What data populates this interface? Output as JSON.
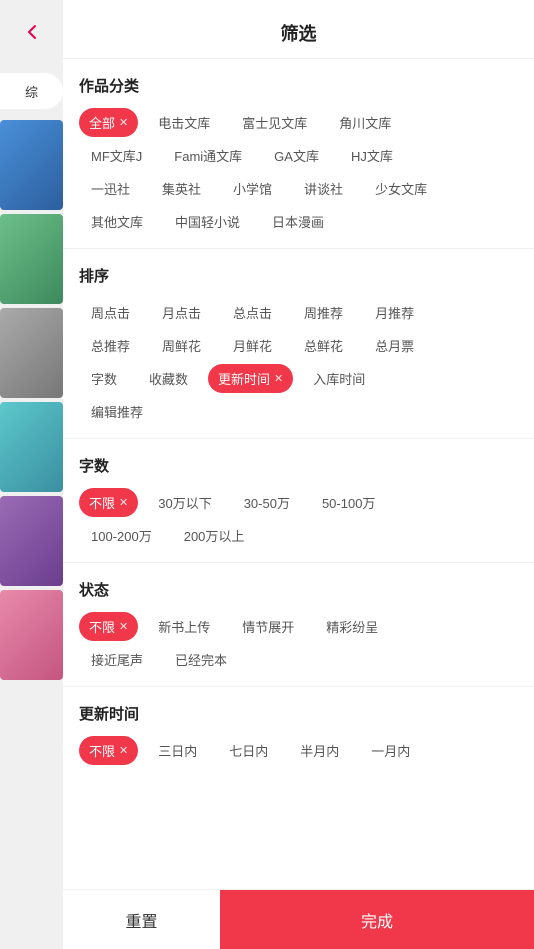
{
  "header": {
    "title": "筛选",
    "back_icon": "‹"
  },
  "sidebar": {
    "tab_label": "综",
    "cards": [
      {
        "color": "blue"
      },
      {
        "color": "green"
      },
      {
        "color": "gray"
      },
      {
        "color": "teal"
      },
      {
        "color": "purple"
      },
      {
        "color": "pink"
      }
    ]
  },
  "sections": {
    "category": {
      "title": "作品分类",
      "tags": [
        {
          "label": "全部",
          "active": true
        },
        {
          "label": "电击文库",
          "active": false
        },
        {
          "label": "富士见文库",
          "active": false
        },
        {
          "label": "角川文库",
          "active": false
        },
        {
          "label": "MF文库J",
          "active": false
        },
        {
          "label": "Fami通文库",
          "active": false
        },
        {
          "label": "GA文库",
          "active": false
        },
        {
          "label": "HJ文库",
          "active": false
        },
        {
          "label": "一迅社",
          "active": false
        },
        {
          "label": "集英社",
          "active": false
        },
        {
          "label": "小学馆",
          "active": false
        },
        {
          "label": "讲谈社",
          "active": false
        },
        {
          "label": "少女文库",
          "active": false
        },
        {
          "label": "其他文库",
          "active": false
        },
        {
          "label": "中国轻小说",
          "active": false
        },
        {
          "label": "日本漫画",
          "active": false
        }
      ]
    },
    "sort": {
      "title": "排序",
      "tags": [
        {
          "label": "周点击",
          "active": false
        },
        {
          "label": "月点击",
          "active": false
        },
        {
          "label": "总点击",
          "active": false
        },
        {
          "label": "周推荐",
          "active": false
        },
        {
          "label": "月推荐",
          "active": false
        },
        {
          "label": "总推荐",
          "active": false
        },
        {
          "label": "周鲜花",
          "active": false
        },
        {
          "label": "月鲜花",
          "active": false
        },
        {
          "label": "总鲜花",
          "active": false
        },
        {
          "label": "总月票",
          "active": false
        },
        {
          "label": "字数",
          "active": false
        },
        {
          "label": "收藏数",
          "active": false
        },
        {
          "label": "更新时间",
          "active": true
        },
        {
          "label": "入库时间",
          "active": false
        },
        {
          "label": "编辑推荐",
          "active": false
        }
      ]
    },
    "words": {
      "title": "字数",
      "tags": [
        {
          "label": "不限",
          "active": true
        },
        {
          "label": "30万以下",
          "active": false
        },
        {
          "label": "30-50万",
          "active": false
        },
        {
          "label": "50-100万",
          "active": false
        },
        {
          "label": "100-200万",
          "active": false
        },
        {
          "label": "200万以上",
          "active": false
        }
      ]
    },
    "status": {
      "title": "状态",
      "tags": [
        {
          "label": "不限",
          "active": true
        },
        {
          "label": "新书上传",
          "active": false
        },
        {
          "label": "情节展开",
          "active": false
        },
        {
          "label": "精彩纷呈",
          "active": false
        },
        {
          "label": "接近尾声",
          "active": false
        },
        {
          "label": "已经完本",
          "active": false
        }
      ]
    },
    "update_time": {
      "title": "更新时间",
      "tags": [
        {
          "label": "不限",
          "active": true
        },
        {
          "label": "三日内",
          "active": false
        },
        {
          "label": "七日内",
          "active": false
        },
        {
          "label": "半月内",
          "active": false
        },
        {
          "label": "一月内",
          "active": false
        }
      ]
    }
  },
  "footer": {
    "reset_label": "重置",
    "confirm_label": "完成"
  },
  "colors": {
    "accent": "#f0384a"
  }
}
